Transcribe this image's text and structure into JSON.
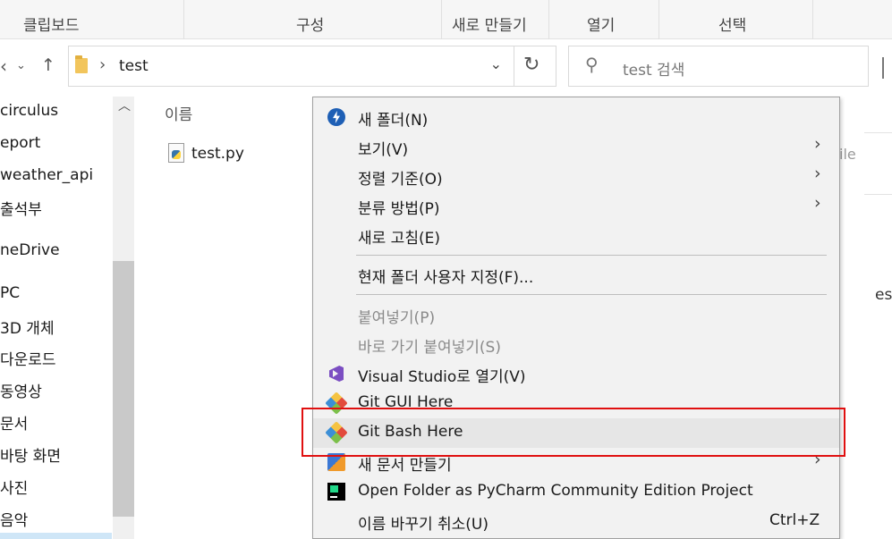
{
  "ribbon": {
    "clipboard": "클립보드",
    "organize": "구성",
    "new": "새로 만들기",
    "open": "열기",
    "select": "선택"
  },
  "address": {
    "path": "test",
    "search_placeholder": "test 검색"
  },
  "nav_pane": {
    "items": [
      "circulus",
      "eport",
      "weather_api",
      "출석부",
      "neDrive",
      " PC",
      "3D 개체",
      "다운로드",
      "동영상",
      "문서",
      "바탕 화면",
      "사진",
      "음악"
    ]
  },
  "file_list": {
    "column_name": "이름",
    "files": [
      "test.py"
    ],
    "right_ghost_1": "ile",
    "right_ghost_2": "es"
  },
  "context_menu": {
    "new_folder": "새 폴더(N)",
    "view": "보기(V)",
    "sort_by": "정렬 기준(O)",
    "group_by": "분류 방법(P)",
    "refresh": "새로 고침(E)",
    "customize": "현재 폴더 사용자 지정(F)...",
    "paste": "붙여넣기(P)",
    "paste_shortcut": "바로 가기 붙여넣기(S)",
    "open_vs": "Visual Studio로 열기(V)",
    "git_gui": "Git GUI Here",
    "git_bash": "Git Bash Here",
    "new_item": "새 문서 만들기",
    "pycharm": "Open Folder as PyCharm Community Edition Project",
    "undo_rename": "이름 바꾸기 취소(U)",
    "undo_shortcut": "Ctrl+Z"
  },
  "colors": {
    "highlight_border": "#e01010",
    "menu_background": "#f2f2f2"
  }
}
